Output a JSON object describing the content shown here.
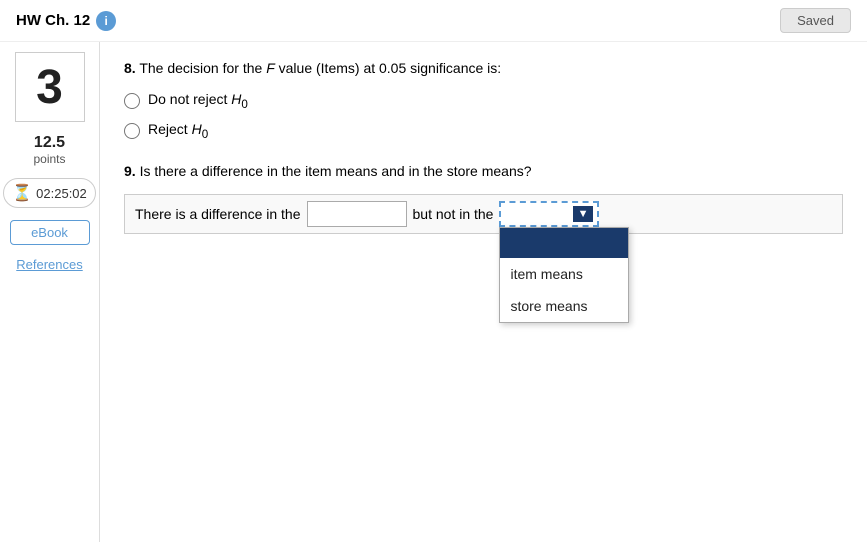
{
  "topbar": {
    "title": "HW Ch. 12",
    "info_icon": "i",
    "saved_label": "Saved"
  },
  "sidebar": {
    "question_number": "3",
    "points_value": "12.5",
    "points_label": "points",
    "timer": "02:25:02",
    "ebook_label": "eBook",
    "references_label": "References"
  },
  "q8": {
    "number": "8.",
    "text": "The decision for the",
    "italic_part": "F",
    "text2": "value (Items) at 0.05 significance is:",
    "option1": "Do not reject",
    "option1_h": "H",
    "option1_sub": "0",
    "option2": "Reject",
    "option2_h": "H",
    "option2_sub": "0"
  },
  "q9": {
    "number": "9.",
    "text": "Is there a difference in the item means and in the store means?",
    "sentence_prefix": "There is a difference in the",
    "sentence_middle": "but not in the",
    "dropdown_options": [
      "item means",
      "store means"
    ],
    "selected_label": ""
  }
}
